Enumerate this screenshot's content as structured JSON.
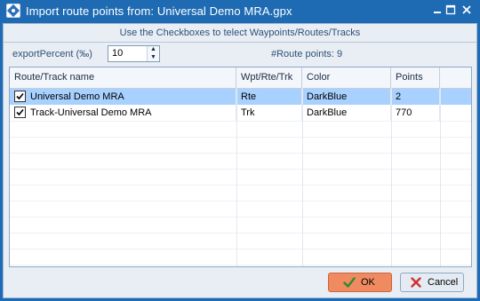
{
  "window": {
    "title": "Import route points from: Universal Demo MRA.gpx"
  },
  "hint": "Use the Checkboxes to telect Waypoints/Routes/Tracks",
  "export_percent": {
    "label": "exportPercent (‰)",
    "value": "10"
  },
  "route_points_label": "#Route points: 9",
  "table": {
    "columns": [
      "Route/Track name",
      "Wpt/Rte/Trk",
      "Color",
      "Points"
    ],
    "rows": [
      {
        "checked": true,
        "name": "Universal Demo MRA",
        "type": "Rte",
        "color": "DarkBlue",
        "points": "2",
        "selected": true
      },
      {
        "checked": true,
        "name": "Track-Universal Demo MRA",
        "type": "Trk",
        "color": "DarkBlue",
        "points": "770",
        "selected": false
      }
    ]
  },
  "buttons": {
    "ok": "OK",
    "cancel": "Cancel"
  },
  "colors": {
    "titlebar": "#1f6bb3",
    "selection": "#a8d1ff",
    "ok_button": "#f08b61"
  }
}
